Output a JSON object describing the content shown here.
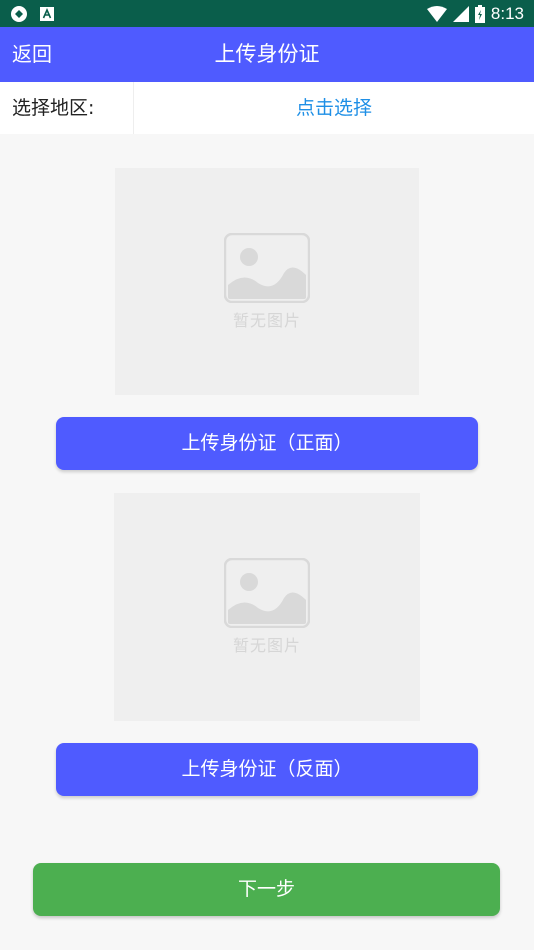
{
  "status_bar": {
    "time": "8:13",
    "icons": [
      "app-notification-icon",
      "font-notification-icon",
      "wifi-icon",
      "signal-icon",
      "battery-icon"
    ]
  },
  "app_bar": {
    "back_label": "返回",
    "title": "上传身份证"
  },
  "region": {
    "label": "选择地区:",
    "select_label": "点击选择",
    "select_color": "#1e8fe6"
  },
  "front": {
    "placeholder_text": "暂无图片",
    "button_label": "上传身份证（正面）"
  },
  "back": {
    "placeholder_text": "暂无图片",
    "button_label": "上传身份证（反面）"
  },
  "next_button_label": "下一步",
  "colors": {
    "status_bar": "#0a5e4b",
    "primary": "#4f5bff",
    "success": "#4caf50"
  }
}
